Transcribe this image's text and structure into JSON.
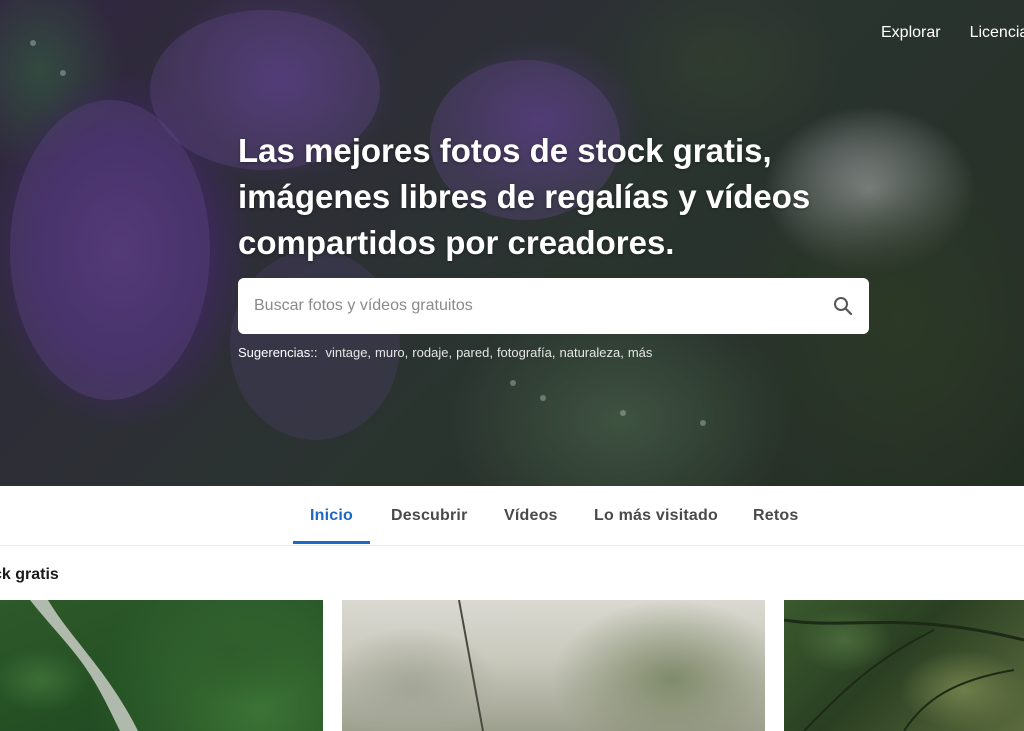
{
  "top_nav": {
    "explore": "Explorar",
    "license": "Licencia"
  },
  "hero": {
    "headline": "Las mejores fotos de stock gratis, imágenes libres de regalías y vídeos compartidos por creadores.",
    "search": {
      "placeholder": "Buscar fotos y vídeos gratuitos",
      "value": "",
      "icon": "search-icon"
    },
    "suggestions_label": "Sugerencias::",
    "suggestions": [
      "vintage",
      "muro",
      "rodaje",
      "pared",
      "fotografía",
      "naturaleza",
      "más"
    ]
  },
  "tabs": [
    {
      "label": "Inicio",
      "active": true
    },
    {
      "label": "Descubrir",
      "active": false
    },
    {
      "label": "Vídeos",
      "active": false
    },
    {
      "label": "Lo más visitado",
      "active": false
    },
    {
      "label": "Retos",
      "active": false
    }
  ],
  "section": {
    "title": "ck gratis"
  },
  "colors": {
    "accent": "#1c68c4",
    "tab_text": "#4a4a4a",
    "white": "#ffffff"
  }
}
